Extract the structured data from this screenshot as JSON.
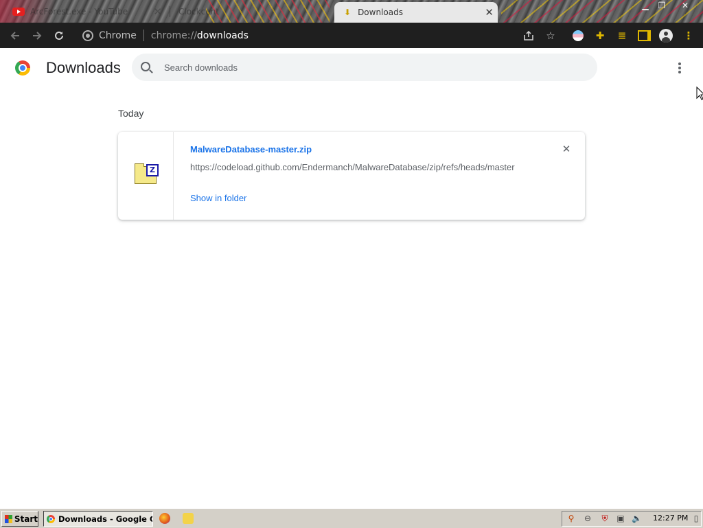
{
  "browser": {
    "tabs": [
      {
        "label": "ArcForest.exe - YouTube",
        "state": "inactive"
      },
      {
        "label": "Clockcent",
        "state": "inactive"
      },
      {
        "label": "Downloads",
        "state": "active"
      }
    ],
    "close_glyph": "✕",
    "omnibox": {
      "chip": "Chrome",
      "scheme": "chrome://",
      "host": "downloads"
    },
    "accent": "#1f1f1f"
  },
  "page": {
    "title": "Downloads",
    "search_placeholder": "Search downloads",
    "section": "Today",
    "downloads": [
      {
        "file_name": "MalwareDatabase-master.zip",
        "url": "https://codeload.github.com/Endermanch/MalwareDatabase/zip/refs/heads/master",
        "action": "Show in folder",
        "icon": "zip-archive-icon"
      }
    ],
    "link_color": "#1a73e8"
  },
  "taskbar": {
    "start_label": "Start",
    "task_label": "Downloads - Google C...",
    "clock": "12:27 PM"
  },
  "icons": [
    "back-icon",
    "forward-icon",
    "reload-icon",
    "share-icon",
    "star-icon",
    "profile-icon",
    "extensions-icon",
    "media-icon",
    "side-panel-icon",
    "account-icon",
    "menu-icon"
  ]
}
